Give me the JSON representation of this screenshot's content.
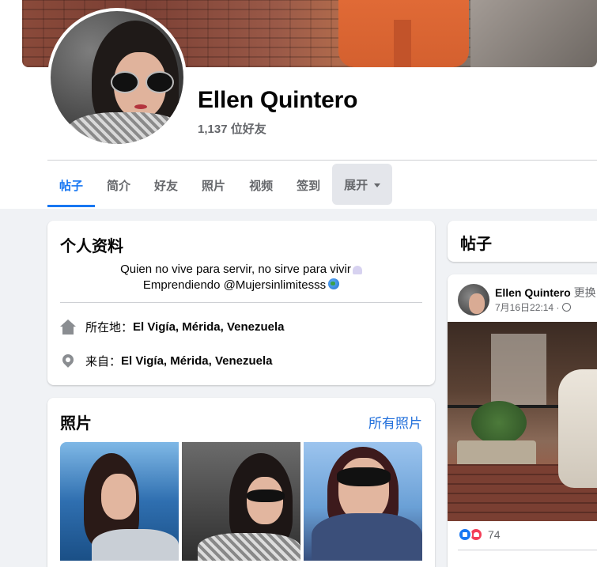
{
  "profile": {
    "name": "Ellen Quintero",
    "friends": "1,137 位好友"
  },
  "tabs": [
    {
      "label": "帖子",
      "active": true
    },
    {
      "label": "简介"
    },
    {
      "label": "好友"
    },
    {
      "label": "照片"
    },
    {
      "label": "视频"
    },
    {
      "label": "签到"
    },
    {
      "label": "展开"
    }
  ],
  "intro": {
    "title": "个人资料",
    "bio_line1": "Quien no vive para servir, no sirve para vivir",
    "bio_line2": "Emprendiendo @Mujersinlimitesss",
    "lives_label": "所在地：",
    "lives_value": "El Vigía, Mérida, Venezuela",
    "from_label": "来自：",
    "from_value": "El Vigía, Mérida, Venezuela"
  },
  "photos": {
    "title": "照片",
    "all_link": "所有照片"
  },
  "posts": {
    "title": "帖子",
    "author": "Ellen Quintero",
    "action": "更换",
    "time": "7月16日22:14 ·",
    "reaction_count": "74"
  },
  "colors": {
    "accent": "#1877f2",
    "link": "#216fdb",
    "secondary_text": "#65676b",
    "page_bg": "#f0f2f5"
  }
}
